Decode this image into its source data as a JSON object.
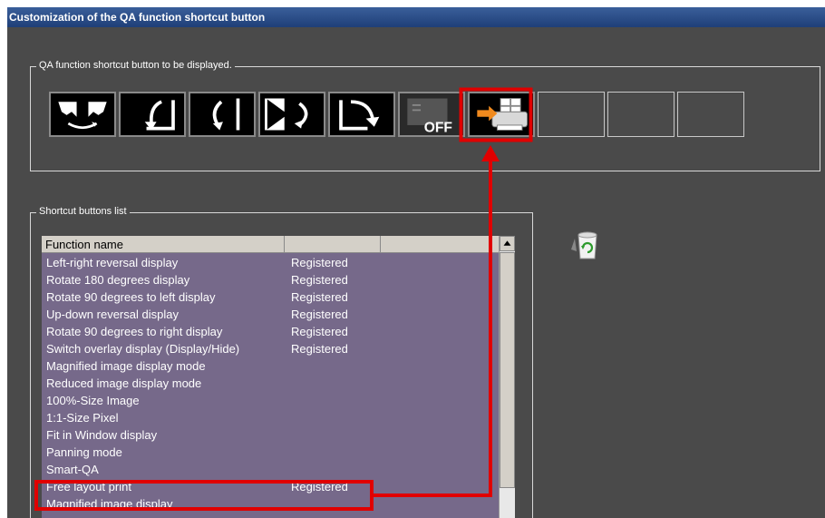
{
  "window": {
    "title": "Customization of the QA function shortcut button"
  },
  "qa_group": {
    "label": "QA function shortcut button to be displayed.",
    "buttons": [
      {
        "icon": "left-right-reversal-icon"
      },
      {
        "icon": "rotate-left-icon"
      },
      {
        "icon": "rotate-180-icon"
      },
      {
        "icon": "up-down-reversal-icon"
      },
      {
        "icon": "rotate-right-icon"
      },
      {
        "icon": "overlay-off-icon",
        "text": "OFF"
      },
      {
        "icon": "free-layout-print-icon"
      },
      {
        "icon": "empty-slot"
      },
      {
        "icon": "empty-slot"
      },
      {
        "icon": "empty-slot"
      }
    ]
  },
  "list_group": {
    "label": "Shortcut buttons list",
    "columns": [
      "Function name",
      "",
      ""
    ],
    "rows": [
      {
        "name": "Left-right reversal display",
        "status": "Registered"
      },
      {
        "name": "Rotate 180 degrees display",
        "status": "Registered"
      },
      {
        "name": "Rotate 90 degrees to left display",
        "status": "Registered"
      },
      {
        "name": "Up-down reversal display",
        "status": "Registered"
      },
      {
        "name": "Rotate 90 degrees to right display",
        "status": "Registered"
      },
      {
        "name": "Switch overlay display (Display/Hide)",
        "status": "Registered"
      },
      {
        "name": "Magnified image display mode",
        "status": ""
      },
      {
        "name": "Reduced image display mode",
        "status": ""
      },
      {
        "name": "100%-Size Image",
        "status": ""
      },
      {
        "name": "1:1-Size Pixel",
        "status": ""
      },
      {
        "name": "Fit in Window display",
        "status": ""
      },
      {
        "name": "Panning mode",
        "status": ""
      },
      {
        "name": "Smart-QA",
        "status": ""
      },
      {
        "name": "Free layout print",
        "status": "Registered"
      },
      {
        "name": "Magnified image display",
        "status": ""
      }
    ]
  },
  "colors": {
    "window_bg": "#4a4a4a",
    "list_bg": "#76698a",
    "highlight": "#e00000",
    "title_bg": "#1f3f78"
  },
  "icons": {
    "trash": "recycle-bin-icon"
  }
}
